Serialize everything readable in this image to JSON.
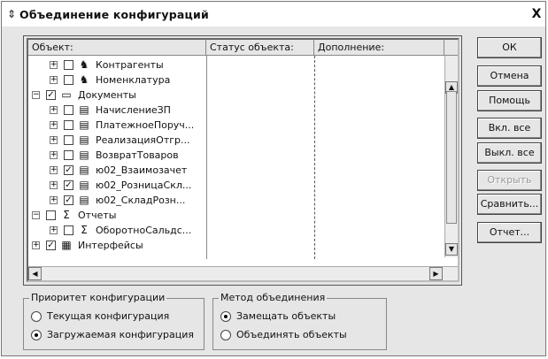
{
  "window": {
    "title": "Объединение конфигураций",
    "close_glyph": "X",
    "title_icon": "pin-icon"
  },
  "table": {
    "columns": [
      "Объект:",
      "Статус объекта:",
      "Дополнение:"
    ],
    "rows": [
      {
        "expander": "+",
        "checked": false,
        "icon": "contractors-icon",
        "label": "Контрагенты"
      },
      {
        "expander": "+",
        "checked": false,
        "icon": "nomenclature-icon",
        "label": "Номенклатура"
      },
      {
        "expander": "−",
        "checked": true,
        "icon": "folder-icon",
        "label": "Документы"
      },
      {
        "expander": "+",
        "checked": false,
        "icon": "document-icon",
        "label": "НачислениеЗП"
      },
      {
        "expander": "+",
        "checked": false,
        "icon": "document-icon",
        "label": "ПлатежноеПоруч..."
      },
      {
        "expander": "+",
        "checked": false,
        "icon": "document-icon",
        "label": "РеализацияОтгр..."
      },
      {
        "expander": "+",
        "checked": false,
        "icon": "document-icon",
        "label": "ВозвратТоваров"
      },
      {
        "expander": "+",
        "checked": true,
        "icon": "document-icon",
        "label": "ю02_Взаимозачет"
      },
      {
        "expander": "+",
        "checked": true,
        "icon": "document-icon",
        "label": "ю02_РозницаСкл..."
      },
      {
        "expander": "+",
        "checked": true,
        "icon": "document-icon",
        "label": "ю02_СкладРозн..."
      },
      {
        "expander": "−",
        "checked": false,
        "icon": "report-icon",
        "label": "Отчеты"
      },
      {
        "expander": "+",
        "checked": false,
        "icon": "report-icon",
        "label": "ОборотноСальдс..."
      },
      {
        "expander": "+",
        "checked": true,
        "icon": "interfaces-icon",
        "label": "Интерфейсы"
      }
    ]
  },
  "buttons": {
    "ok": "ОК",
    "cancel": "Отмена",
    "help": "Помощь",
    "enable_all": "Вкл. все",
    "disable_all": "Выкл. все",
    "open": "Открыть",
    "compare": "Сравнить...",
    "report": "Отчет..."
  },
  "priority_group": {
    "legend": "Приоритет конфигурации",
    "options": [
      "Текущая конфигурация",
      "Загружаемая конфигурация"
    ],
    "selected_index": 1
  },
  "method_group": {
    "legend": "Метод объединения",
    "options": [
      "Замещать объекты",
      "Объединять объекты"
    ],
    "selected_index": 0
  }
}
